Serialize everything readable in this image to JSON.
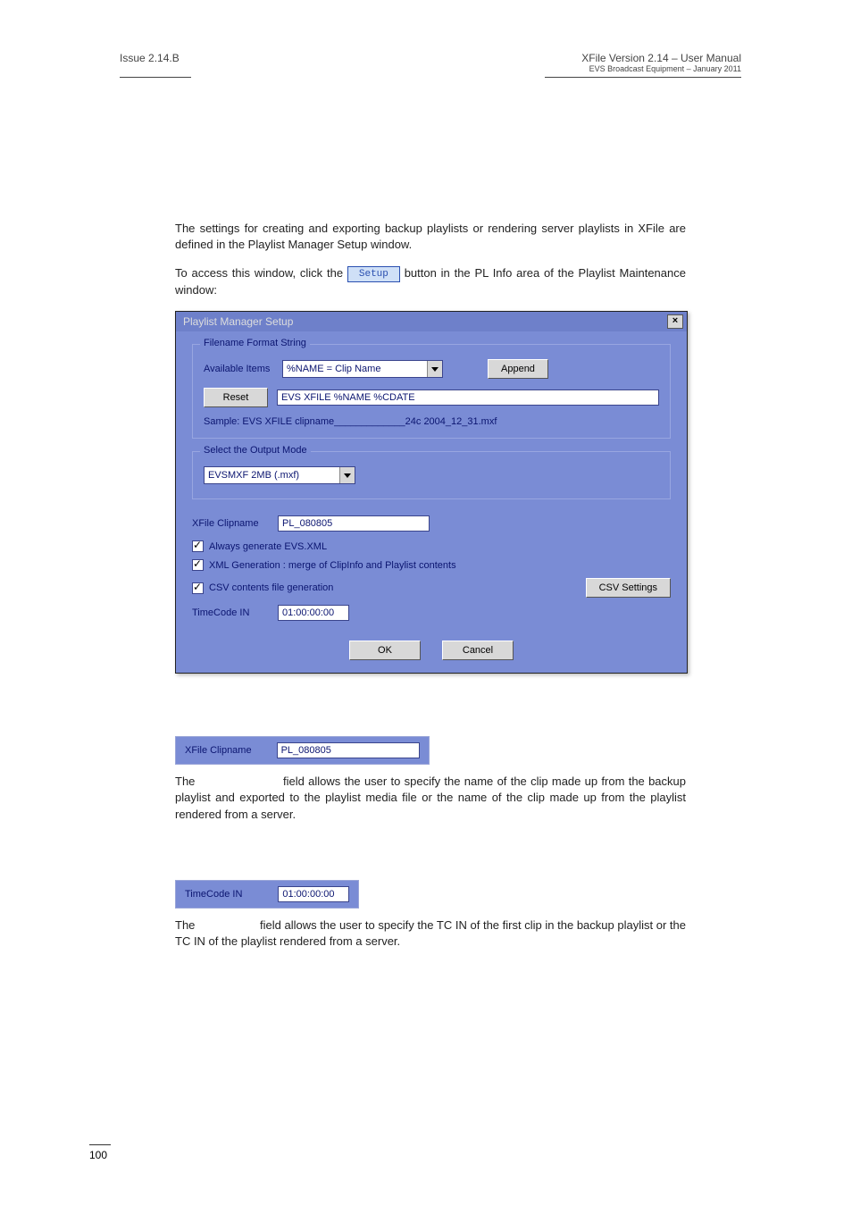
{
  "header": {
    "left": "Issue 2.14.B",
    "right_top": "XFile Version 2.14 – User Manual",
    "right_sub": "EVS Broadcast Equipment – January 2011"
  },
  "intro": {
    "p1": "The settings for creating and exporting backup playlists or rendering server playlists in XFile are defined in the Playlist Manager Setup window.",
    "p2a": "To access this window, click the ",
    "setup_chip": "Setup",
    "p2b": " button in the PL Info area of the Playlist Maintenance window:"
  },
  "dialog": {
    "title": "Playlist Manager Setup",
    "filename_group": {
      "legend": "Filename Format String",
      "available_label": "Available Items",
      "available_select": "%NAME     = Clip Name",
      "append_btn": "Append",
      "reset_btn": "Reset",
      "format_value": "EVS XFILE %NAME %CDATE",
      "sample": "Sample: EVS XFILE clipname_____________24c 2004_12_31.mxf"
    },
    "output_group": {
      "legend": "Select the Output Mode",
      "value": "EVSMXF 2MB (.mxf)"
    },
    "clipname": {
      "label": "XFile Clipname",
      "value": "PL_080805"
    },
    "chk1": "Always generate EVS.XML",
    "chk2": "XML Generation : merge of ClipInfo and Playlist contents",
    "chk3": "CSV contents file generation",
    "csv_btn": "CSV Settings",
    "timecode": {
      "label": "TimeCode IN",
      "value": "01:00:00:00"
    },
    "ok": "OK",
    "cancel": "Cancel"
  },
  "clipname_section": {
    "label": "XFile Clipname",
    "value": "PL_080805",
    "desc": "The                       field allows the user to specify the name of the clip made up from the backup playlist and exported to the playlist media file or the name of the clip made up from the playlist rendered from a server."
  },
  "timecode_section": {
    "label": "TimeCode IN",
    "value": "01:00:00:00",
    "desc": "The                    field allows the user to specify the TC IN of the first clip in the backup playlist or the TC IN of the playlist rendered from a server."
  },
  "page_number": "100"
}
